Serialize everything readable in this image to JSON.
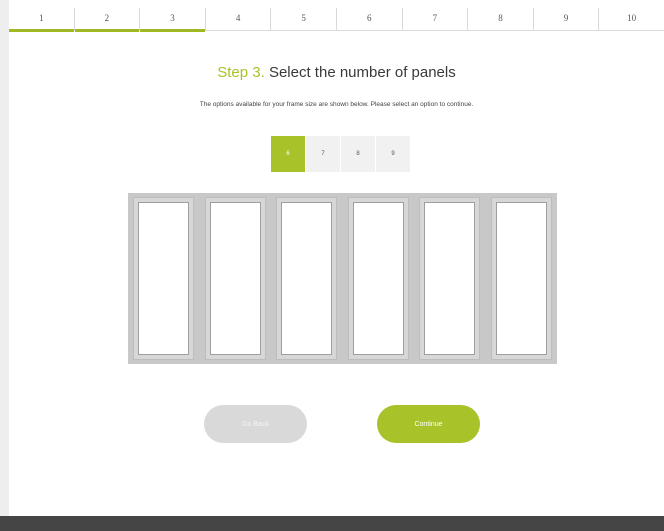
{
  "progress": {
    "steps": [
      "1",
      "2",
      "3",
      "4",
      "5",
      "6",
      "7",
      "8",
      "9",
      "10"
    ],
    "current_step_index": 3
  },
  "heading": {
    "step": "Step 3.",
    "text": "Select the number of panels"
  },
  "instructions": "The options available for your frame size are shown below. Please select an option to continue.",
  "panel_options": {
    "values": [
      "6",
      "7",
      "8",
      "9"
    ],
    "selected": "6"
  },
  "preview": {
    "panel_count": 6
  },
  "buttons": {
    "back": "Go Back",
    "continue": "Continue"
  },
  "colors": {
    "accent": "#a8c229",
    "footer": "#454545"
  }
}
